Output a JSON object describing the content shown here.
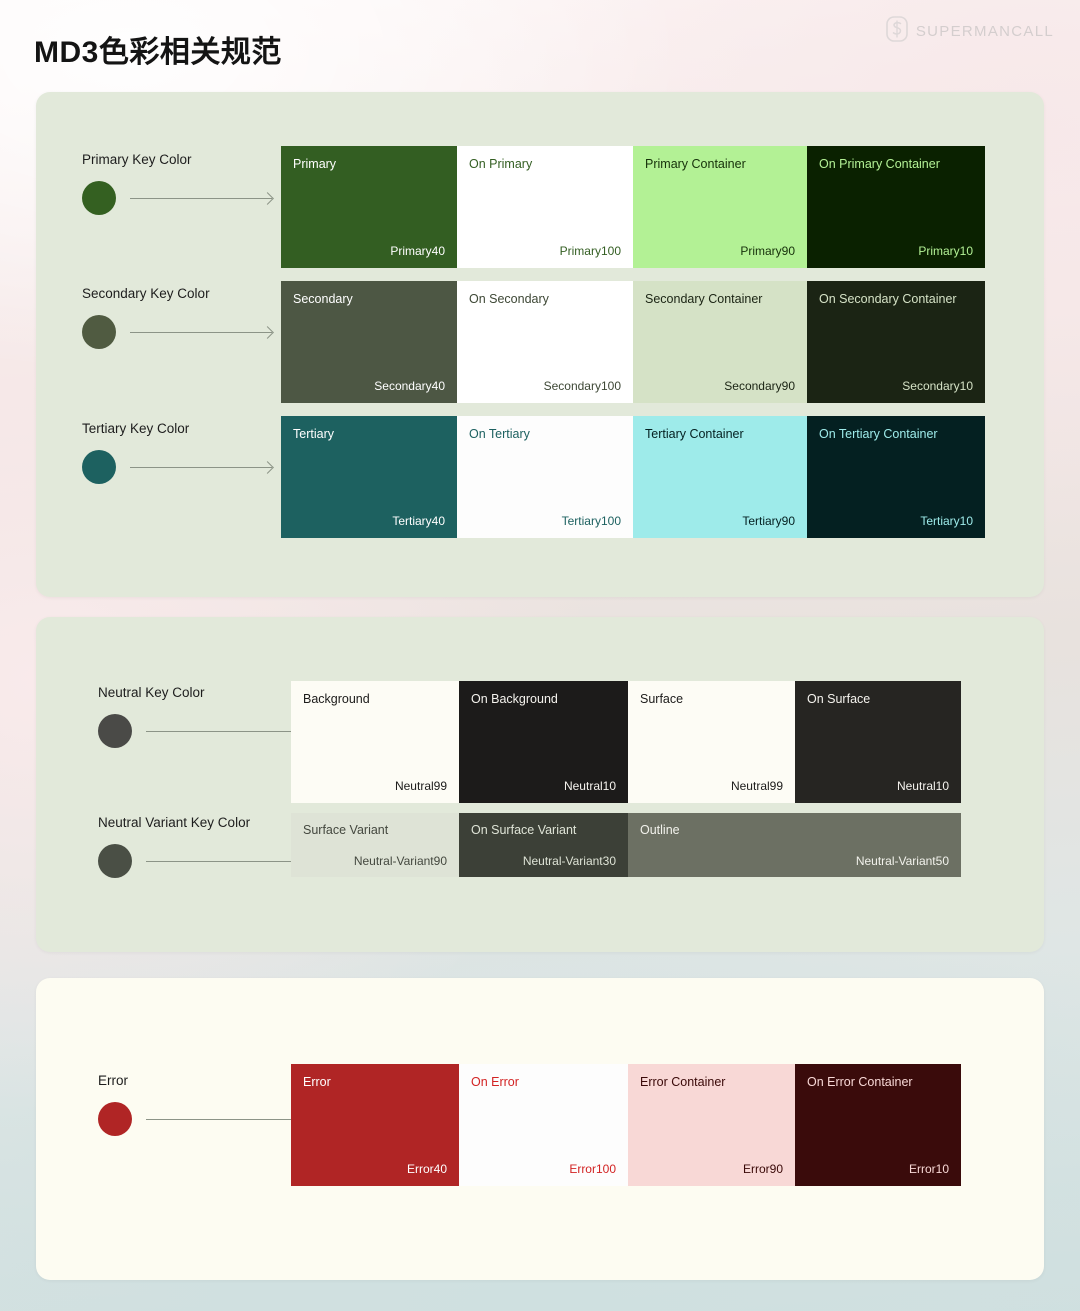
{
  "header": {
    "title": "MD3色彩相关规范",
    "watermark": "SUPERMANCALL",
    "logo_icon": "s-monogram-icon"
  },
  "colors": {
    "page_bg_top": "#fdf6f6",
    "page_bg_bottom": "#cfdfdf",
    "card_green": "#e2e9da",
    "card_cream": "#fdfcf2",
    "arrow": "#8c9487"
  },
  "sections": [
    {
      "id": "key-colors",
      "card_color": "#e2e9da",
      "rows": [
        {
          "key_label": "Primary Key Color",
          "key_dot_color": "#346021",
          "swatches": [
            {
              "name": "Primary",
              "token": "Primary40",
              "bg": "#335E22",
              "fg": "#ffffff"
            },
            {
              "name": "On Primary",
              "token": "Primary100",
              "bg": "#ffffff",
              "fg": "#335E22"
            },
            {
              "name": "Primary Container",
              "token": "Primary90",
              "bg": "#B3F195",
              "fg": "#16310a"
            },
            {
              "name": "On Primary Container",
              "token": "Primary10",
              "bg": "#0A2100",
              "fg": "#b3f195"
            }
          ]
        },
        {
          "key_label": "Secondary Key Color",
          "key_dot_color": "#505b41",
          "swatches": [
            {
              "name": "Secondary",
              "token": "Secondary40",
              "bg": "#4D5744",
              "fg": "#ffffff"
            },
            {
              "name": "On Secondary",
              "token": "Secondary100",
              "bg": "#ffffff",
              "fg": "#3d4735"
            },
            {
              "name": "Secondary Container",
              "token": "Secondary90",
              "bg": "#D5E2C6",
              "fg": "#1b2414"
            },
            {
              "name": "On Secondary Container",
              "token": "Secondary10",
              "bg": "#1B2414",
              "fg": "#d5e2c6"
            }
          ]
        },
        {
          "key_label": "Tertiary Key Color",
          "key_dot_color": "#1d6160",
          "swatches": [
            {
              "name": "Tertiary",
              "token": "Tertiary40",
              "bg": "#1D6160",
              "fg": "#ffffff"
            },
            {
              "name": "On Tertiary",
              "token": "Tertiary100",
              "bg": "#fdfdfd",
              "fg": "#1d6160"
            },
            {
              "name": "Tertiary Container",
              "token": "Tertiary90",
              "bg": "#9EEBEA",
              "fg": "#042021"
            },
            {
              "name": "On Tertiary Container",
              "token": "Tertiary10",
              "bg": "#042021",
              "fg": "#9eebea"
            }
          ]
        }
      ]
    },
    {
      "id": "neutral-colors",
      "card_color": "#e2e9da",
      "rows": [
        {
          "key_label": "Neutral Key Color",
          "key_dot_color": "#4a4a47",
          "swatches": [
            {
              "name": "Background",
              "token": "Neutral99",
              "bg": "#FDFCF5",
              "fg": "#1c1b1a"
            },
            {
              "name": "On Background",
              "token": "Neutral10",
              "bg": "#1C1B1A",
              "fg": "#f5f3ee"
            },
            {
              "name": "Surface",
              "token": "Neutral99",
              "bg": "#FDFCF5",
              "fg": "#1c1b1a"
            },
            {
              "name": "On Surface",
              "token": "Neutral10",
              "bg": "#262522",
              "fg": "#f5f3ee"
            }
          ]
        },
        {
          "key_label": "Neutral Variant Key Color",
          "key_dot_color": "#4a4f45",
          "swatches": [
            {
              "name": "Surface Variant",
              "token": "Neutral-Variant90",
              "bg": "#DEE3D6",
              "fg": "#44483f"
            },
            {
              "name": "On Surface Variant",
              "token": "Neutral-Variant30",
              "bg": "#3C4037",
              "fg": "#dee3d6"
            },
            {
              "name": "Outline",
              "token": "Neutral-Variant50",
              "bg": "#6C7063",
              "fg": "#f2f2ec"
            }
          ]
        }
      ]
    },
    {
      "id": "error-colors",
      "card_color": "#fdfcf2",
      "rows": [
        {
          "key_label": "Error",
          "key_dot_color": "#b02525",
          "swatches": [
            {
              "name": "Error",
              "token": "Error40",
              "bg": "#B02525",
              "fg": "#ffffff"
            },
            {
              "name": "On Error",
              "token": "Error100",
              "bg": "#fdfdfd",
              "fg": "#d22323"
            },
            {
              "name": "Error Container",
              "token": "Error90",
              "bg": "#F8D8D6",
              "fg": "#3a0908"
            },
            {
              "name": "On Error Container",
              "token": "Error10",
              "bg": "#3A0B0B",
              "fg": "#f8d8d6"
            }
          ]
        }
      ]
    }
  ]
}
